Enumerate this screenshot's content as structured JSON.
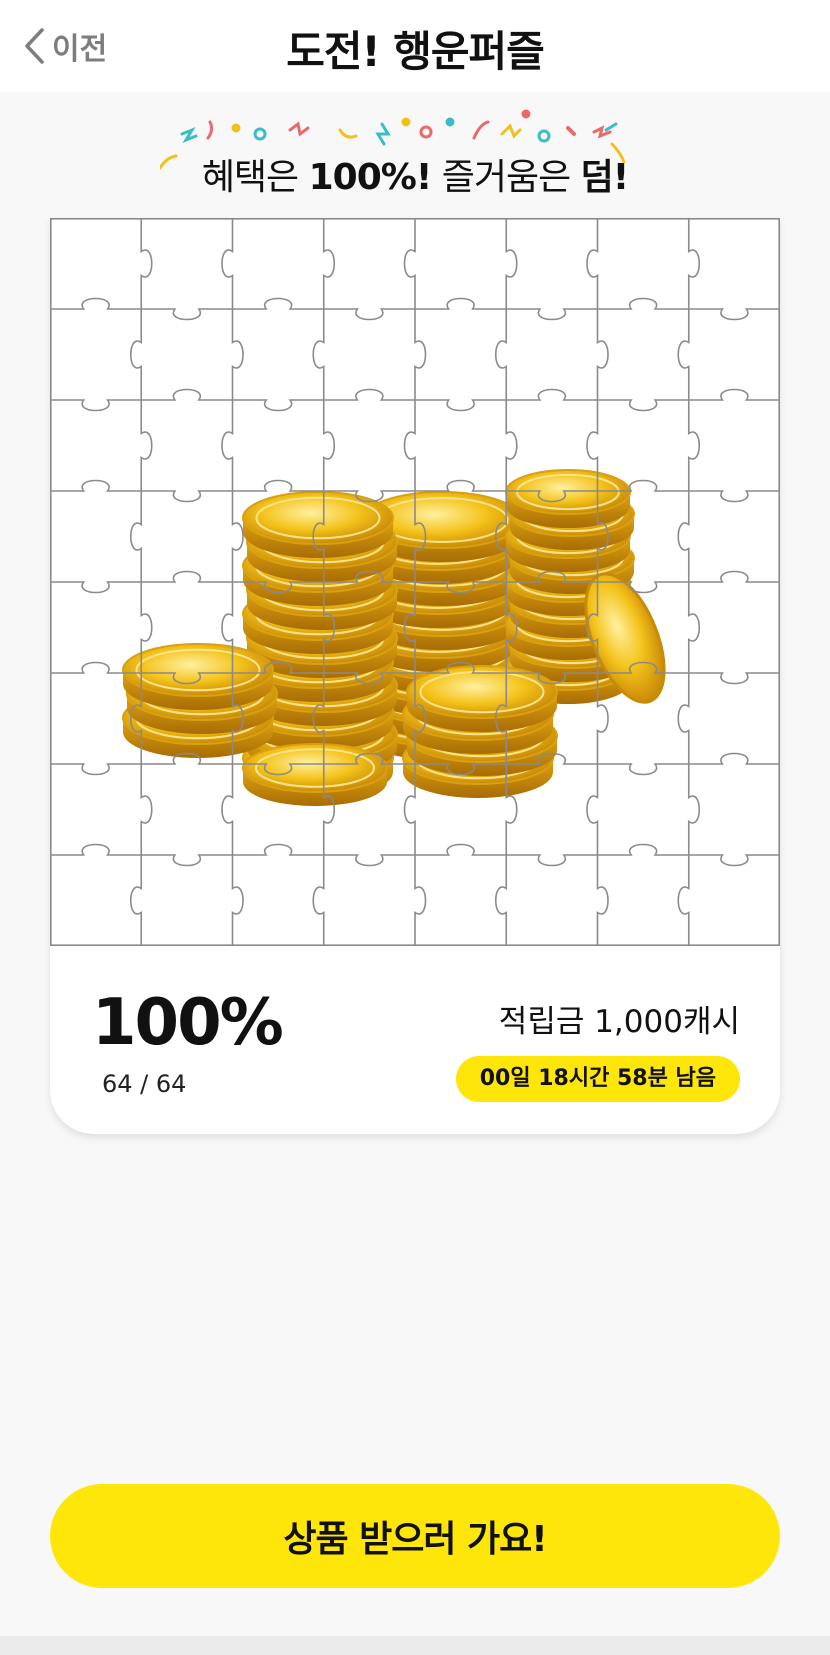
{
  "header": {
    "back_label": "이전",
    "title": "도전! 행운퍼즐",
    "back_icon": "chevron-left-icon"
  },
  "slogan": {
    "part1": "혜택은 ",
    "part2": "100%!",
    "part3": " 즐거움은 ",
    "part4": "덤!"
  },
  "puzzle": {
    "image": "gold-coins-stack",
    "grid_rows": 8,
    "grid_cols": 8,
    "pieces_completed": 64,
    "pieces_total": 64
  },
  "progress": {
    "percent_label": "100%",
    "count_label": "64 / 64"
  },
  "reward": {
    "label": "적립금 1,000캐시",
    "timer": "00일 18시간 58분 남음"
  },
  "cta": {
    "label": "상품 받으러 가요!"
  },
  "colors": {
    "accent": "#ffe60a",
    "background": "#f8f8f8",
    "coin_gold": "#f2c018",
    "grid_line": "#8a8a8a"
  }
}
